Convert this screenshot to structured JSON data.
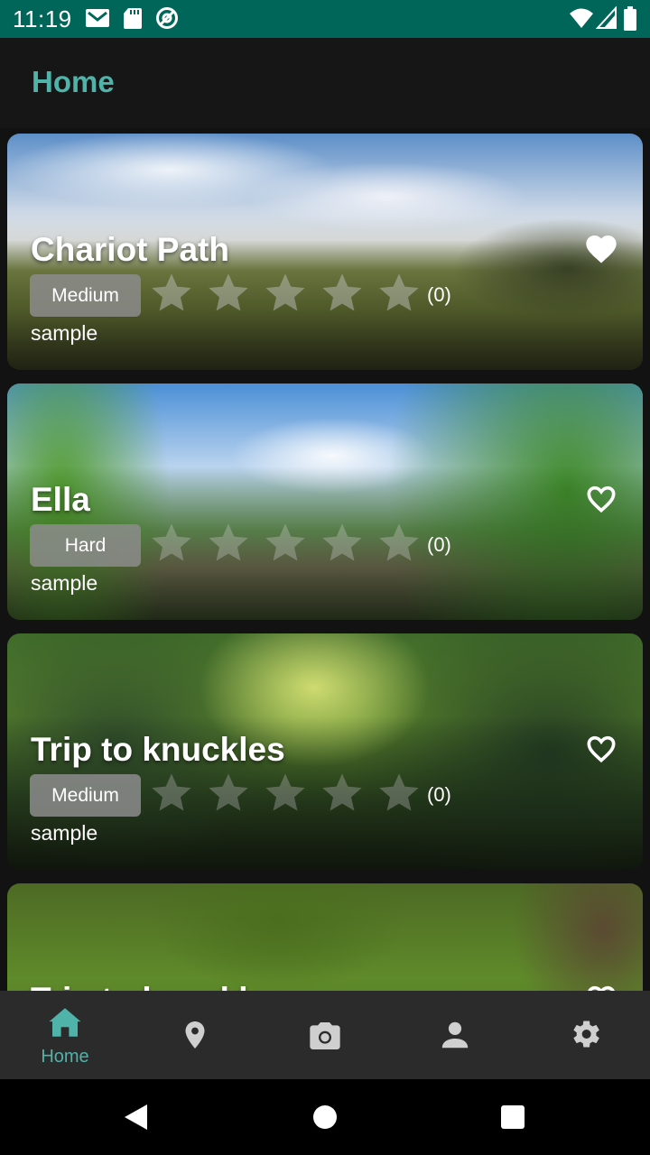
{
  "status_bar": {
    "time": "11:19",
    "left_icons": [
      "gmail-icon",
      "sd-card-icon",
      "at-sign-icon"
    ],
    "right_icons": [
      "wifi-icon",
      "signal-icon",
      "battery-icon"
    ]
  },
  "app_bar": {
    "title": "Home"
  },
  "trips": [
    {
      "title": "Chariot Path",
      "difficulty": "Medium",
      "rating_count": "(0)",
      "subtitle": "sample",
      "favorite": true,
      "rating": 0
    },
    {
      "title": "Ella",
      "difficulty": "Hard",
      "rating_count": "(0)",
      "subtitle": "sample",
      "favorite": false,
      "rating": 0
    },
    {
      "title": "Trip to knuckles",
      "difficulty": "Medium",
      "rating_count": "(0)",
      "subtitle": "sample",
      "favorite": false,
      "rating": 0
    },
    {
      "title": "Trip to knuckles",
      "difficulty": "",
      "rating_count": "",
      "subtitle": "",
      "favorite": false,
      "rating": 0
    }
  ],
  "bottom_nav": [
    {
      "label": "Home",
      "icon": "home-icon",
      "active": true
    },
    {
      "label": "",
      "icon": "location-pin-icon",
      "active": false
    },
    {
      "label": "",
      "icon": "camera-icon",
      "active": false
    },
    {
      "label": "",
      "icon": "person-icon",
      "active": false
    },
    {
      "label": "",
      "icon": "settings-icon",
      "active": false
    }
  ],
  "system_nav": [
    "back-icon",
    "home-circle-icon",
    "recents-icon"
  ],
  "colors": {
    "accent": "#4fb3aa",
    "status_bar": "#00665a",
    "background": "#121212",
    "nav_bar": "#2b2b2b"
  }
}
